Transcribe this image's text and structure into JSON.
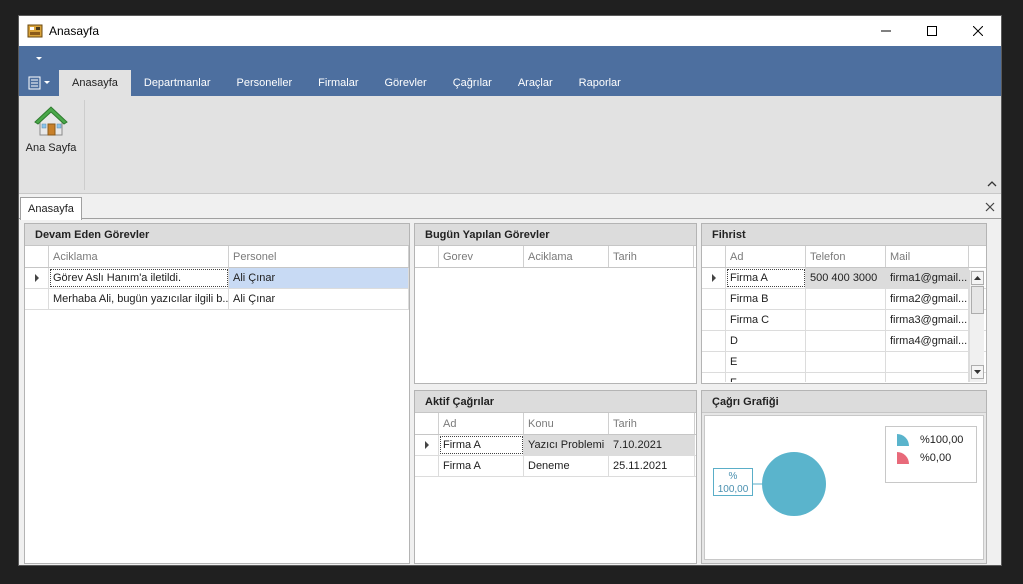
{
  "window": {
    "title": "Anasayfa"
  },
  "ribbon": {
    "tabs": [
      {
        "label": "Anasayfa",
        "active": true
      },
      {
        "label": "Departmanlar"
      },
      {
        "label": "Personeller"
      },
      {
        "label": "Firmalar"
      },
      {
        "label": "Görevler"
      },
      {
        "label": "Çağrılar"
      },
      {
        "label": "Araçlar"
      },
      {
        "label": "Raporlar"
      }
    ],
    "home_button_label": "Ana Sayfa"
  },
  "document_tab": {
    "label": "Anasayfa"
  },
  "panels": {
    "devam": {
      "title": "Devam Eden Görevler",
      "columns": [
        "Aciklama",
        "Personel"
      ],
      "rows": [
        [
          "Görev Aslı Hanım'a iletildi.",
          "Ali Çınar"
        ],
        [
          "Merhaba Ali, bugün yazıcılar ilgili b...",
          "Ali Çınar"
        ]
      ]
    },
    "bugun": {
      "title": "Bugün Yapılan Görevler",
      "columns": [
        "Gorev",
        "Aciklama",
        "Tarih"
      ]
    },
    "fihrist": {
      "title": "Fihrist",
      "columns": [
        "Ad",
        "Telefon",
        "Mail"
      ],
      "rows": [
        [
          "Firma A",
          "500 400 3000",
          "firma1@gmail...."
        ],
        [
          "Firma B",
          "",
          "firma2@gmail...."
        ],
        [
          "Firma C",
          "",
          "firma3@gmail...."
        ],
        [
          "D",
          "",
          "firma4@gmail...."
        ],
        [
          "E",
          "",
          ""
        ],
        [
          "F",
          "",
          ""
        ]
      ]
    },
    "aktif": {
      "title": "Aktif Çağrılar",
      "columns": [
        "Ad",
        "Konu",
        "Tarih"
      ],
      "rows": [
        [
          "Firma A",
          "Yazıcı Problemi",
          "7.10.2021"
        ],
        [
          "Firma A",
          "Deneme",
          "25.11.2021"
        ]
      ]
    },
    "grafik": {
      "title": "Çağrı Grafiği",
      "pie_label_line1": "%",
      "pie_label_line2": "100,00",
      "legend": [
        {
          "label": "%100,00",
          "color": "#5ab4cc"
        },
        {
          "label": "%0,00",
          "color": "#e86a7a"
        }
      ]
    }
  },
  "colors": {
    "ribbon": "#4d6f9f",
    "selection": "#c8daf4",
    "pie_primary": "#5ab4cc",
    "pie_secondary": "#e86a7a"
  }
}
